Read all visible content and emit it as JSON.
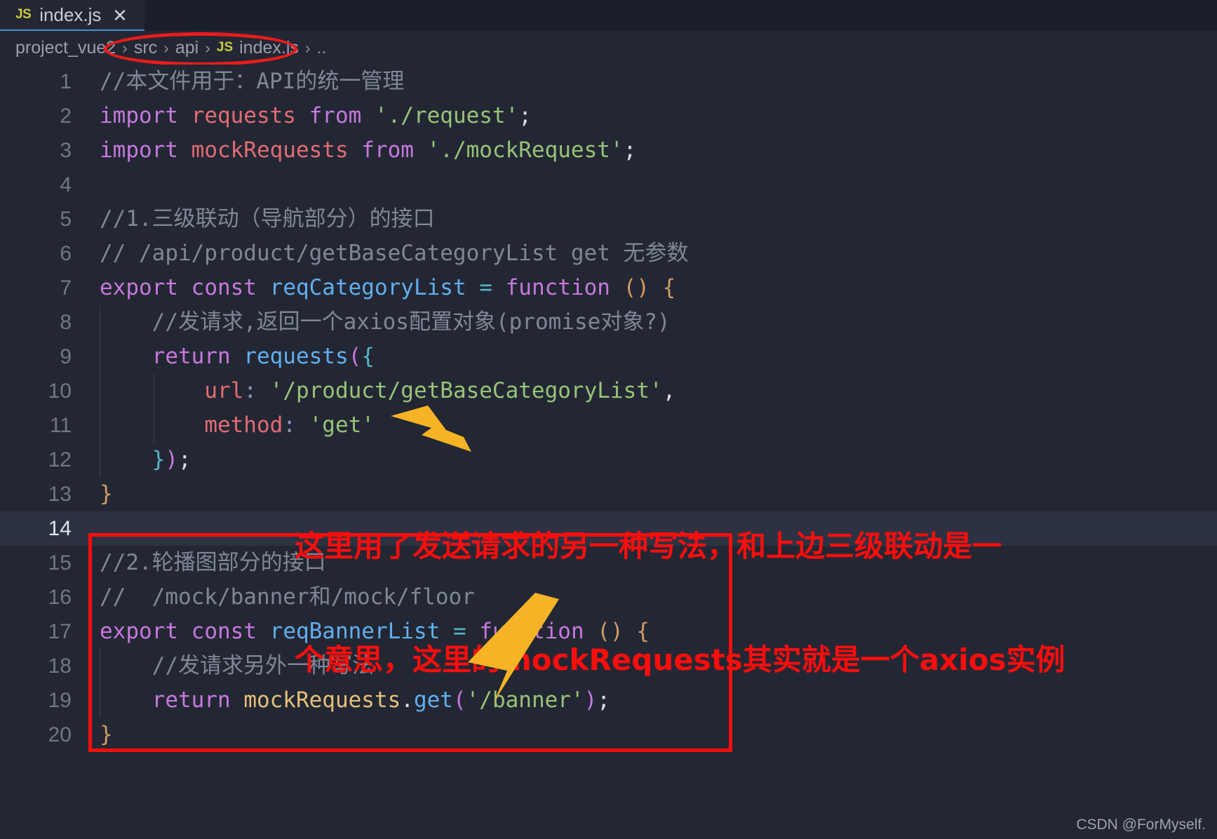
{
  "window": {
    "background_color": "#232733",
    "tab_bar_color": "#1b1f2b"
  },
  "tab": {
    "file_icon_label": "JS",
    "title": "index.js",
    "close_glyph": "✕"
  },
  "breadcrumb": {
    "root": "project_vue2",
    "separator": "›",
    "items": [
      "src",
      "api"
    ],
    "file_icon_label": "JS",
    "file": "index.js",
    "trailing": ".."
  },
  "annotations": {
    "ellipse_color": "#f01b1b",
    "box_color": "#fd0d0d",
    "arrow_color": "#f5b325",
    "red_text_color": "#fd0d0d",
    "red_text_line1": "这里用了发送请求的另一种写法，和上边三级联动是一",
    "red_text_line2": "个意思，这里的mockRequests其实就是一个axios实例"
  },
  "watermark": {
    "text": "CSDN @ForMyself."
  },
  "editor": {
    "active_line": 14,
    "line_numbers": [
      "1",
      "2",
      "3",
      "4",
      "5",
      "6",
      "7",
      "8",
      "9",
      "10",
      "11",
      "12",
      "13",
      "14",
      "15",
      "16",
      "17",
      "18",
      "19",
      "20"
    ],
    "lines": [
      {
        "n": "1",
        "text": "//本文件用于：API的统一管理"
      },
      {
        "n": "2",
        "text": "import requests from './request';"
      },
      {
        "n": "3",
        "text": "import mockRequests from './mockRequest';"
      },
      {
        "n": "4",
        "text": ""
      },
      {
        "n": "5",
        "text": "//1.三级联动（导航部分）的接口"
      },
      {
        "n": "6",
        "text": "// /api/product/getBaseCategoryList get 无参数"
      },
      {
        "n": "7",
        "text": "export const reqCategoryList = function () {"
      },
      {
        "n": "8",
        "text": "    //发请求,返回一个axios配置对象(promise对象?)"
      },
      {
        "n": "9",
        "text": "    return requests({"
      },
      {
        "n": "10",
        "text": "        url: '/product/getBaseCategoryList',"
      },
      {
        "n": "11",
        "text": "        method: 'get'"
      },
      {
        "n": "12",
        "text": "    });"
      },
      {
        "n": "13",
        "text": "}"
      },
      {
        "n": "14",
        "text": ""
      },
      {
        "n": "15",
        "text": "//2.轮播图部分的接口"
      },
      {
        "n": "16",
        "text": "//  /mock/banner和/mock/floor"
      },
      {
        "n": "17",
        "text": "export const reqBannerList = function () {"
      },
      {
        "n": "18",
        "text": "    //发请求另外一种写法"
      },
      {
        "n": "19",
        "text": "    return mockRequests.get('/banner');"
      },
      {
        "n": "20",
        "text": "}"
      }
    ],
    "tokens": {
      "l1_comment": "//本文件用于：API的统一管理",
      "l2_kw": "import",
      "l2_var": "requests",
      "l2_from": "from",
      "l2_str": "'./request'",
      "l2_semi": ";",
      "l3_kw": "import",
      "l3_var": "mockRequests",
      "l3_from": "from",
      "l3_str": "'./mockRequest'",
      "l3_semi": ";",
      "l5_comment": "//1.三级联动（导航部分）的接口",
      "l6_comment": "// /api/product/getBaseCategoryList get 无参数",
      "l7_export": "export",
      "l7_const": "const",
      "l7_name": "reqCategoryList",
      "l7_eq": "=",
      "l7_function": "function",
      "l7_parens": "()",
      "l7_brace": "{",
      "l8_comment": "//发请求,返回一个axios配置对象(promise对象?)",
      "l9_return": "return",
      "l9_call": "requests",
      "l9_open": "(",
      "l9_brace": "{",
      "l10_key": "url",
      "l10_colon": ":",
      "l10_str": "'/product/getBaseCategoryList'",
      "l10_comma": ",",
      "l11_key": "method",
      "l11_colon": ":",
      "l11_str": "'get'",
      "l12_brace": "}",
      "l12_paren": ")",
      "l12_semi": ";",
      "l13_brace": "}",
      "l15_comment": "//2.轮播图部分的接口",
      "l16_comment": "//  /mock/banner和/mock/floor",
      "l17_export": "export",
      "l17_const": "const",
      "l17_name": "reqBannerList",
      "l17_eq": "=",
      "l17_function": "function",
      "l17_parens": "()",
      "l17_brace": "{",
      "l18_comment": "//发请求另外一种写法",
      "l19_return": "return",
      "l19_obj": "mockRequests",
      "l19_dot": ".",
      "l19_method": "get",
      "l19_open": "(",
      "l19_str": "'/banner'",
      "l19_close": ")",
      "l19_semi": ";",
      "l20_brace": "}"
    }
  }
}
